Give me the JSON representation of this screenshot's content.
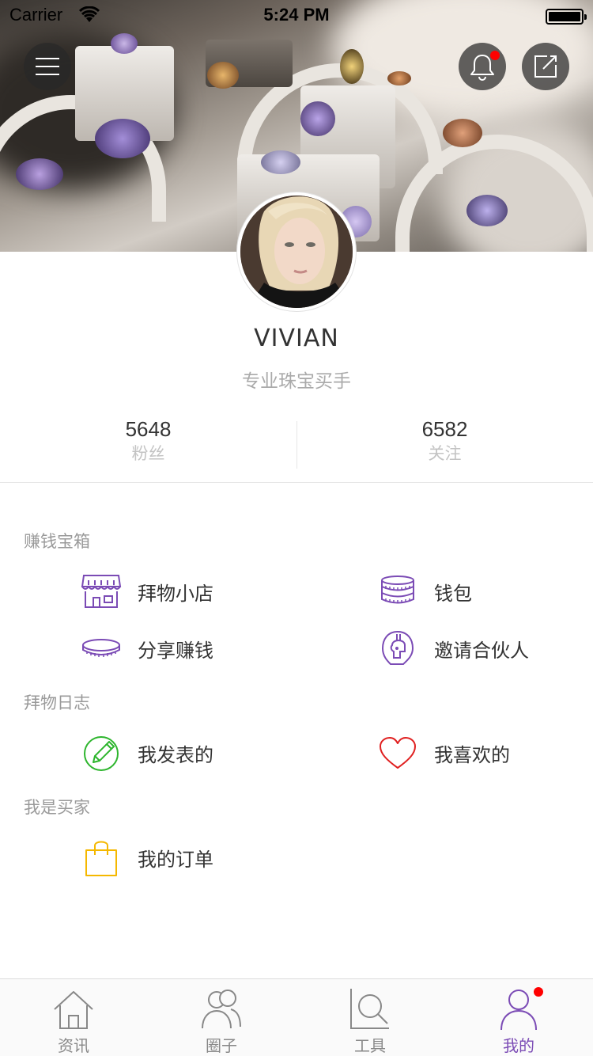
{
  "status_bar": {
    "carrier": "Carrier",
    "time": "5:24 PM"
  },
  "header": {
    "menu_icon": "hamburger-menu-icon",
    "notification_icon": "bell-icon",
    "compose_icon": "compose-edit-icon",
    "notification_dot_color": "#ff0000"
  },
  "profile": {
    "name": "VIVIAN",
    "bio": "专业珠宝买手",
    "followers_count": "5648",
    "followers_label": "粉丝",
    "following_count": "6582",
    "following_label": "关注"
  },
  "sections": [
    {
      "title": "赚钱宝箱",
      "items": [
        {
          "label": "拜物小店",
          "icon": "shop-icon",
          "color": "#7b4bb5"
        },
        {
          "label": "钱包",
          "icon": "coin-stack-icon",
          "color": "#7b4bb5"
        },
        {
          "label": "分享赚钱",
          "icon": "coin-icon",
          "color": "#7b4bb5"
        },
        {
          "label": "邀请合伙人",
          "icon": "partner-helmet-icon",
          "color": "#7b4bb5"
        }
      ]
    },
    {
      "title": "拜物日志",
      "items": [
        {
          "label": "我发表的",
          "icon": "pencil-circle-icon",
          "color": "#2db52d"
        },
        {
          "label": "我喜欢的",
          "icon": "heart-icon",
          "color": "#e02020"
        }
      ]
    },
    {
      "title": "我是买家",
      "items": [
        {
          "label": "我的订单",
          "icon": "shopping-bag-icon",
          "color": "#f5b800"
        }
      ]
    }
  ],
  "tabbar": {
    "tabs": [
      {
        "label": "资讯",
        "icon": "home-icon",
        "active": false
      },
      {
        "label": "圈子",
        "icon": "people-icon",
        "active": false
      },
      {
        "label": "工具",
        "icon": "search-tool-icon",
        "active": false
      },
      {
        "label": "我的",
        "icon": "profile-icon",
        "active": true
      }
    ],
    "active_color": "#7b4bb5",
    "inactive_color": "#888888"
  }
}
